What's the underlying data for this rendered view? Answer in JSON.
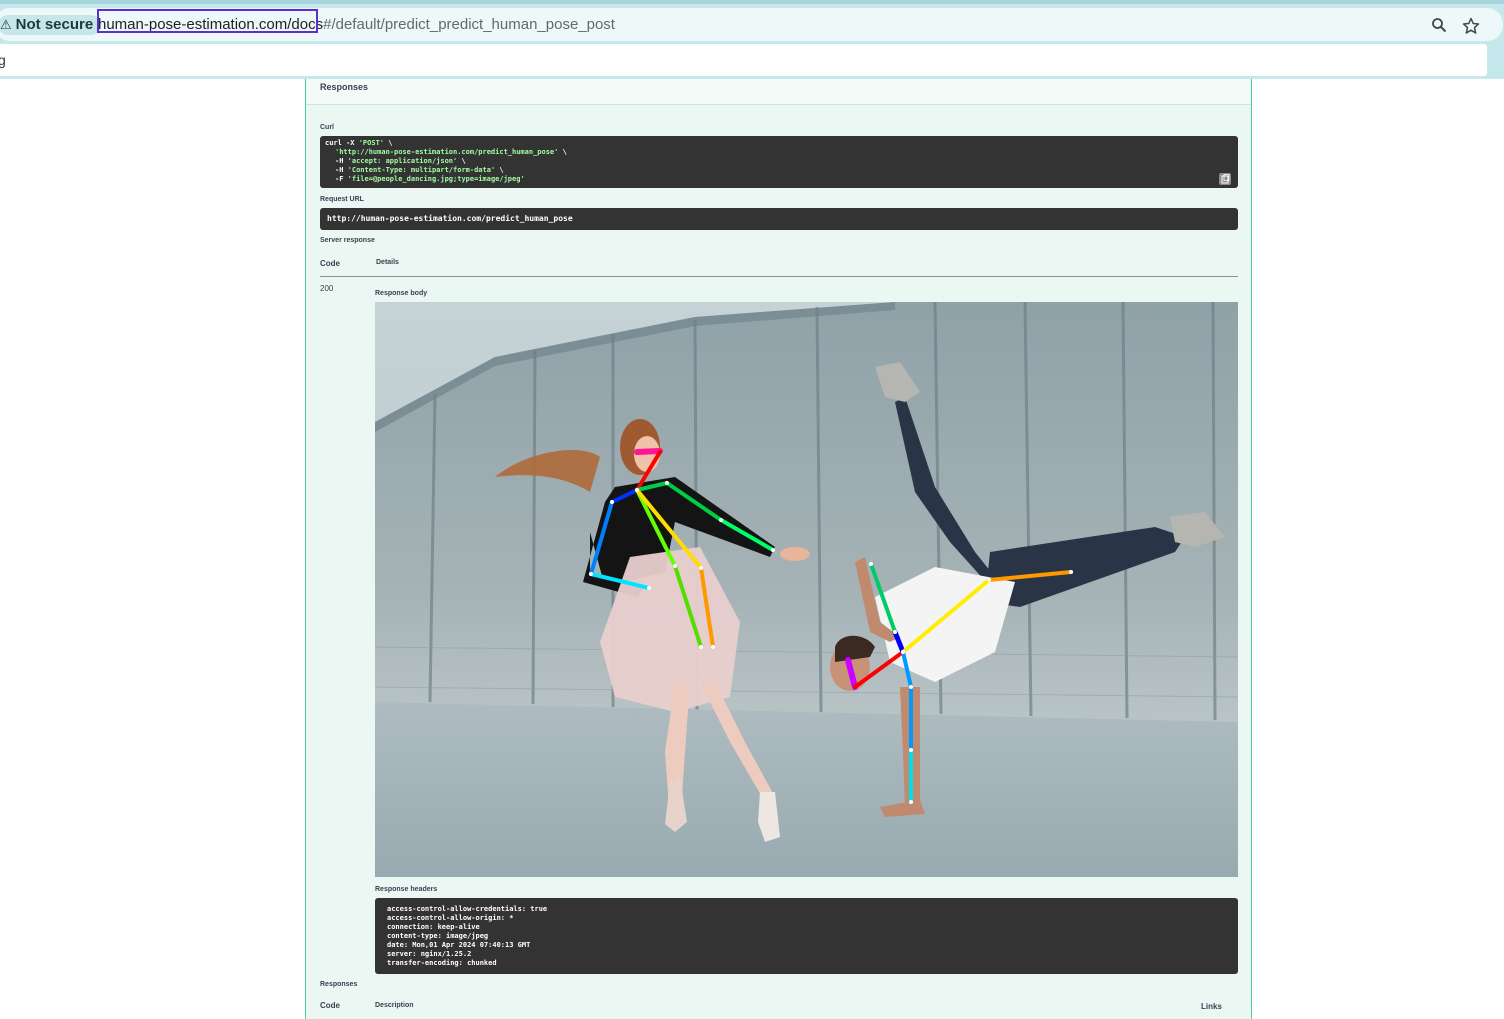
{
  "browser": {
    "security_label": "Not secure",
    "warning_glyph": "⚠",
    "url_host_path": "human-pose-estimation.com/docs",
    "url_fragment": "#/default/predict_predict_human_pose_post",
    "second_bar_text": "g"
  },
  "icons": {
    "search": "search-icon",
    "star": "star-icon",
    "copy": "copy-icon"
  },
  "panel": {
    "title": "Responses",
    "curl_label": "Curl",
    "curl_lines": {
      "l1_cmd": "curl -X ",
      "l1_str": "'POST'",
      "l1_end": " \\",
      "l2_str": "'http://human-pose-estimation.com/predict_human_pose'",
      "l2_end": " \\",
      "l3_cmd": "-H ",
      "l3_str": "'accept: application/json'",
      "l3_end": " \\",
      "l4_cmd": "-H ",
      "l4_str": "'Content-Type: multipart/form-data'",
      "l4_end": " \\",
      "l5_cmd": "-F ",
      "l5_str": "'file=@people_dancing.jpg;type=image/jpeg'"
    },
    "request_url_label": "Request URL",
    "request_url": "http://human-pose-estimation.com/predict_human_pose",
    "server_response_label": "Server response",
    "table_headers": {
      "code": "Code",
      "details": "Details"
    },
    "status_code": "200",
    "response_body_label": "Response body",
    "response_headers_label": "Response headers",
    "response_headers": [
      "access-control-allow-credentials: true",
      "access-control-allow-origin: *",
      "connection: keep-alive",
      "content-type: image/jpeg",
      "date: Mon,01 Apr 2024 07:40:13 GMT",
      "server: nginx/1.25.2",
      "transfer-encoding: chunked"
    ],
    "responses_label": "Responses",
    "footer_headers": {
      "code": "Code",
      "description": "Description",
      "links": "Links"
    }
  },
  "colors": {
    "panel_bg": "#ebf7f2",
    "panel_border": "#49cc90",
    "code_bg": "#333333",
    "string_green": "#a2fca2",
    "url_highlight": "#5a2fd6"
  }
}
